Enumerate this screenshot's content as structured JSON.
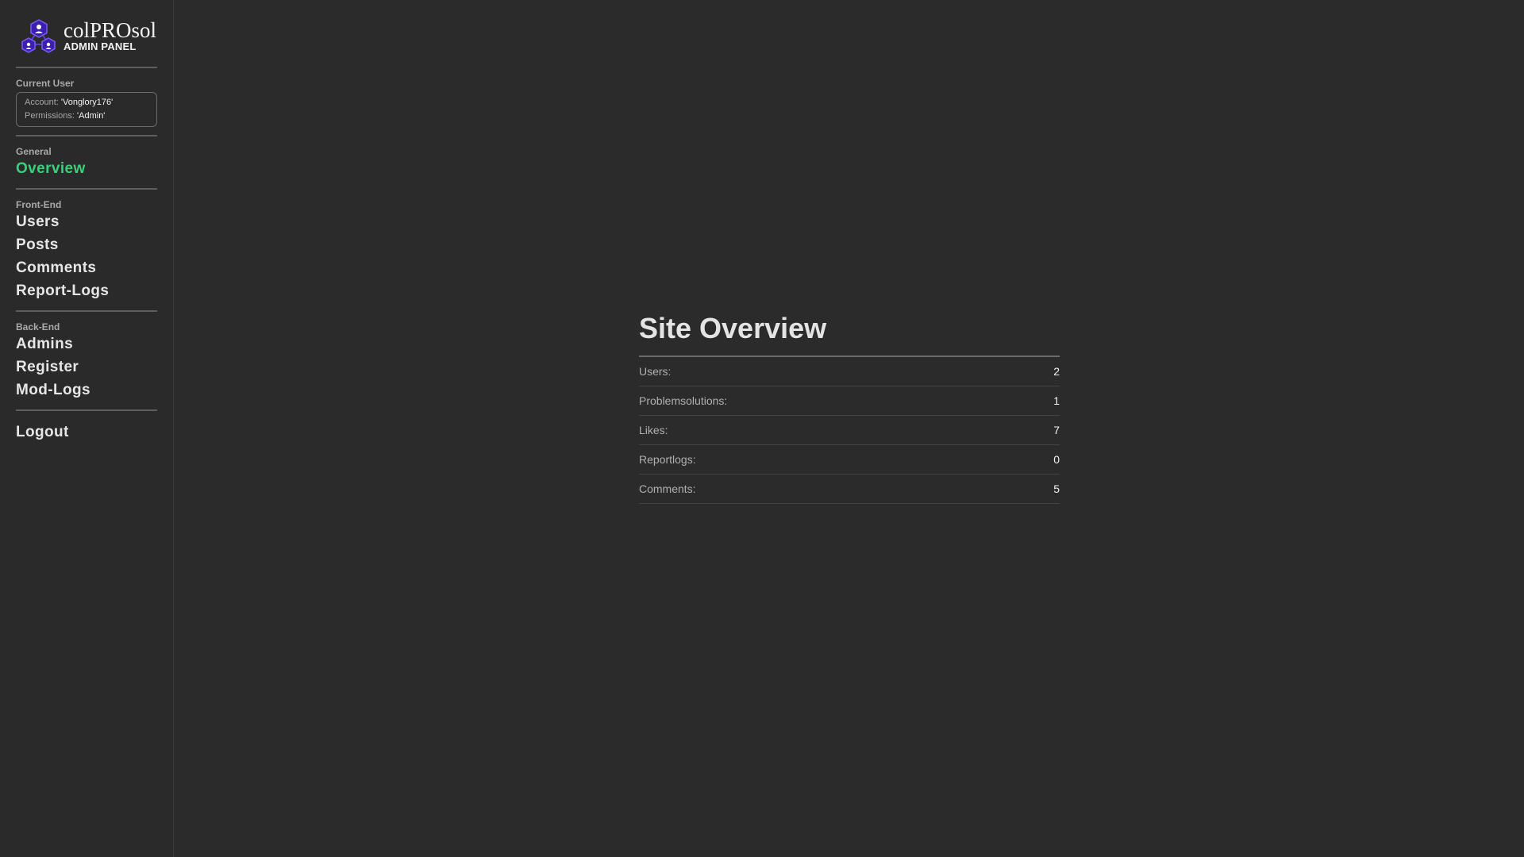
{
  "brand": {
    "name": "colPROsol",
    "subtitle": "ADMIN PANEL",
    "logo_icon": "hexagon-cluster-logo",
    "accent_color": "#5b3bd6"
  },
  "current_user": {
    "label": "Current User",
    "account_label": "Account:",
    "account_value": "'Vonglory176'",
    "permissions_label": "Permissions:",
    "permissions_value": "'Admin'"
  },
  "nav": {
    "general": {
      "label": "General",
      "items": [
        {
          "label": "Overview",
          "active": true
        }
      ]
    },
    "front_end": {
      "label": "Front-End",
      "items": [
        {
          "label": "Users"
        },
        {
          "label": "Posts"
        },
        {
          "label": "Comments"
        },
        {
          "label": "Report-Logs"
        }
      ]
    },
    "back_end": {
      "label": "Back-End",
      "items": [
        {
          "label": "Admins"
        },
        {
          "label": "Register"
        },
        {
          "label": "Mod-Logs"
        }
      ]
    },
    "logout_label": "Logout",
    "active_color": "#3ad07b"
  },
  "overview": {
    "title": "Site Overview",
    "stats": [
      {
        "label": "Users:",
        "value": "2"
      },
      {
        "label": "Problemsolutions:",
        "value": "1"
      },
      {
        "label": "Likes:",
        "value": "7"
      },
      {
        "label": "Reportlogs:",
        "value": "0"
      },
      {
        "label": "Comments:",
        "value": "5"
      }
    ]
  }
}
